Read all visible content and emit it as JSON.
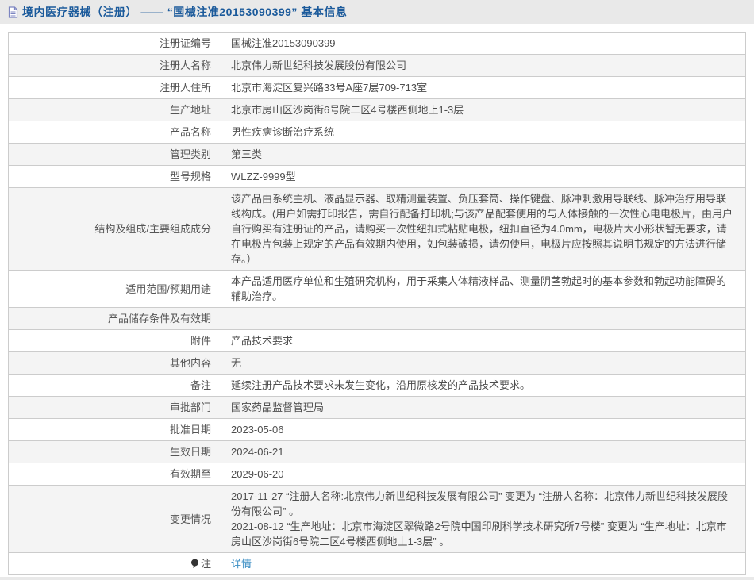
{
  "colors": {
    "header_bg": "#e9e9e9",
    "title_blue": "#1b5a9b",
    "row_alt_bg": "#f4f4f4",
    "border": "#cccccc",
    "text": "#555555",
    "link_blue": "#3d8fc4"
  },
  "header": {
    "icon": "document-icon",
    "title": "境内医疗器械（注册） ——  “国械注准20153090399”  基本信息"
  },
  "table": {
    "rows": [
      {
        "label": "注册证编号",
        "value": "国械注准20153090399"
      },
      {
        "label": "注册人名称",
        "value": "北京伟力新世纪科技发展股份有限公司"
      },
      {
        "label": "注册人住所",
        "value": "北京市海淀区复兴路33号A座7层709-713室"
      },
      {
        "label": "生产地址",
        "value": "北京市房山区沙岗街6号院二区4号楼西侧地上1-3层"
      },
      {
        "label": "产品名称",
        "value": "男性疾病诊断治疗系统"
      },
      {
        "label": "管理类别",
        "value": "第三类"
      },
      {
        "label": "型号规格",
        "value": "WLZZ-9999型"
      },
      {
        "label": "结构及组成/主要组成成分",
        "value": "该产品由系统主机、液晶显示器、取精测量装置、负压套筒、操作键盘、脉冲刺激用导联线、脉冲治疗用导联线构成。(用户如需打印报告，需自行配备打印机;与该产品配套使用的与人体接触的一次性心电电极片，由用户自行购买有注册证的产品，请购买一次性纽扣式粘贴电极，纽扣直径为4.0mm，电极片大小形状暂无要求，请在电极片包装上规定的产品有效期内使用，如包装破损，请勿使用，电极片应按照其说明书规定的方法进行储存。）"
      },
      {
        "label": "适用范围/预期用途",
        "value": "本产品适用医疗单位和生殖研究机构，用于采集人体精液样品、测量阴茎勃起时的基本参数和勃起功能障碍的辅助治疗。"
      },
      {
        "label": "产品储存条件及有效期",
        "value": ""
      },
      {
        "label": "附件",
        "value": "产品技术要求"
      },
      {
        "label": "其他内容",
        "value": "无"
      },
      {
        "label": "备注",
        "value": "延续注册产品技术要求未发生变化，沿用原核发的产品技术要求。"
      },
      {
        "label": "审批部门",
        "value": "国家药品监督管理局"
      },
      {
        "label": "批准日期",
        "value": "2023-05-06"
      },
      {
        "label": "生效日期",
        "value": "2024-06-21"
      },
      {
        "label": "有效期至",
        "value": "2029-06-20"
      },
      {
        "label": "变更情况",
        "lines": [
          "2017-11-27  “注册人名称:北京伟力新世纪科技发展有限公司” 变更为 “注册人名称：北京伟力新世纪科技发展股份有限公司” 。",
          "2021-08-12  “生产地址：北京市海淀区翠微路2号院中国印刷科学技术研究所7号楼” 变更为 “生产地址：北京市房山区沙岗街6号院二区4号楼西侧地上1-3层” 。"
        ]
      },
      {
        "label": "注",
        "note_icon": true,
        "link": "详情"
      }
    ]
  }
}
